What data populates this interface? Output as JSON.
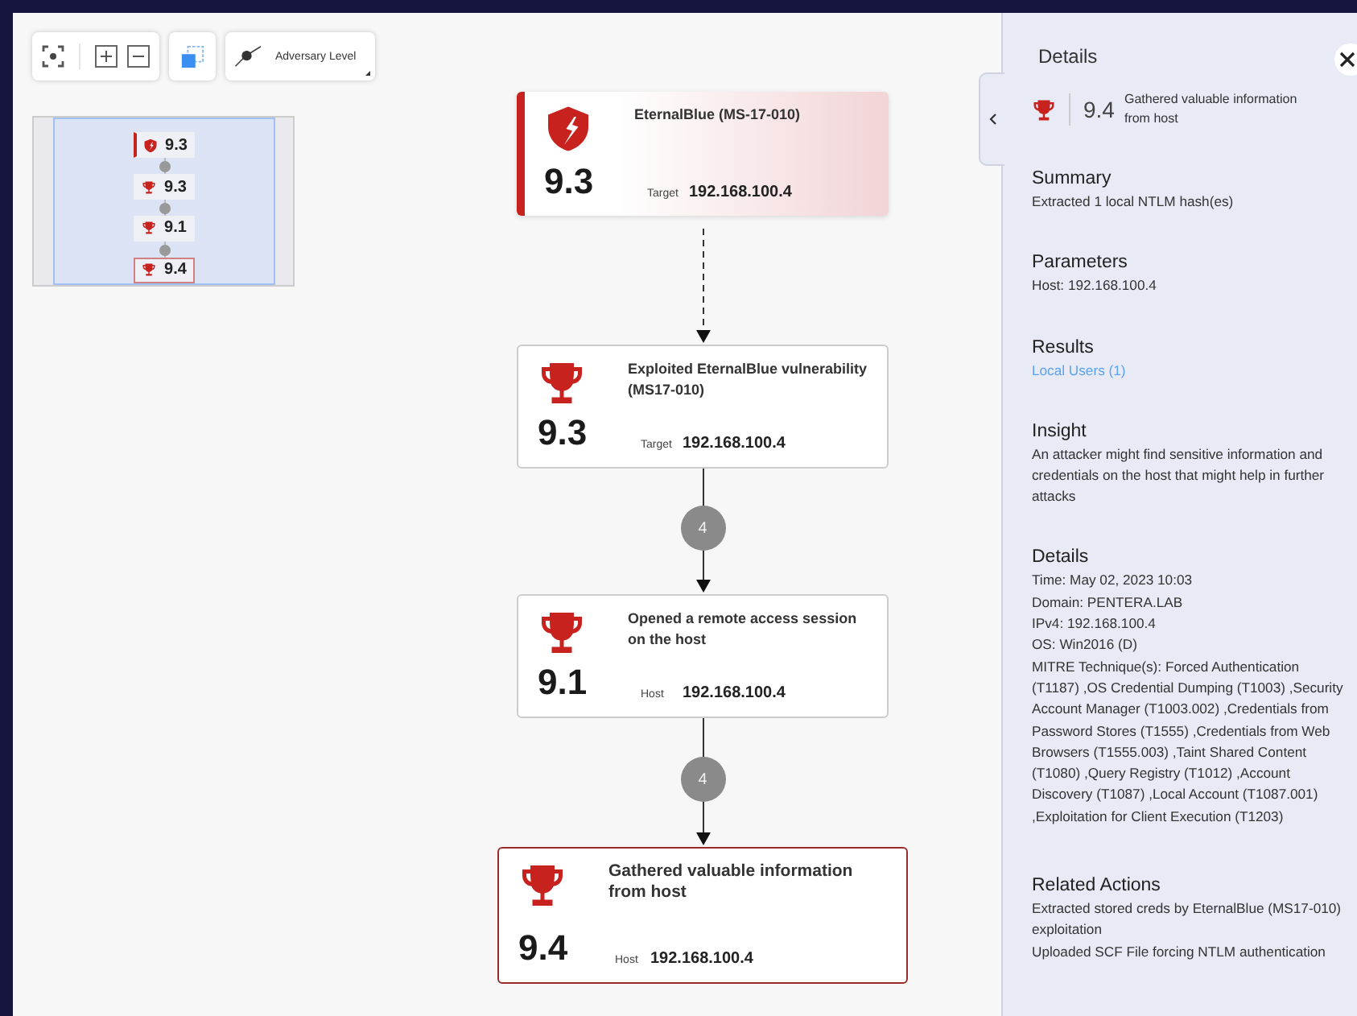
{
  "toolbar": {
    "adversary_level_label": "Adversary Level"
  },
  "minimap": {
    "items": [
      {
        "kind": "vulnerability",
        "score": "9.3",
        "selected": false
      },
      {
        "kind": "achievement",
        "score": "9.3",
        "selected": false
      },
      {
        "kind": "achievement",
        "score": "9.1",
        "selected": false
      },
      {
        "kind": "achievement",
        "score": "9.4",
        "selected": true
      }
    ]
  },
  "nodes": [
    {
      "kind": "vulnerability",
      "title": "EternalBlue (MS-17-010)",
      "score": "9.3",
      "target_label": "Target",
      "target": "192.168.100.4",
      "selected": false
    },
    {
      "kind": "achievement",
      "title": "Exploited EternalBlue vulnerability (MS17-010)",
      "score": "9.3",
      "target_label": "Target",
      "target": "192.168.100.4",
      "selected": false
    },
    {
      "kind": "achievement",
      "title": "Opened a remote access session on the host",
      "score": "9.1",
      "target_label": "Host",
      "target": "192.168.100.4",
      "selected": false
    },
    {
      "kind": "achievement",
      "title": "Gathered valuable information from host",
      "score": "9.4",
      "target_label": "Host",
      "target": "192.168.100.4",
      "selected": true
    }
  ],
  "connectors": [
    {
      "kind": "dashed"
    },
    {
      "kind": "count",
      "count": "4"
    },
    {
      "kind": "count",
      "count": "4"
    }
  ],
  "details_panel": {
    "title": "Details",
    "header": {
      "kind": "achievement",
      "score": "9.4",
      "title": "Gathered valuable information from host"
    },
    "sections": [
      {
        "kind": "text",
        "heading": "Summary",
        "lines": [
          "Extracted 1 local NTLM hash(es)"
        ]
      },
      {
        "kind": "text",
        "heading": "Parameters",
        "lines": [
          "Host: 192.168.100.4"
        ]
      },
      {
        "kind": "links",
        "heading": "Results",
        "lines": [
          "Local Users (1)"
        ]
      },
      {
        "kind": "text",
        "heading": "Insight",
        "lines": [
          "An attacker might find sensitive information and credentials on the host that might help in further attacks"
        ]
      },
      {
        "kind": "text",
        "heading": "Details",
        "lines": [
          "Time: May 02, 2023 10:03",
          "Domain: PENTERA.LAB",
          "IPv4: 192.168.100.4",
          "OS: Win2016 (D)",
          "MITRE Technique(s): Forced Authentication (T1187) ,OS Credential Dumping (T1003) ,Security Account Manager (T1003.002) ,Credentials from Password Stores (T1555) ,Credentials from Web Browsers (T1555.003) ,Taint Shared Content (T1080) ,Query Registry (T1012) ,Account Discovery (T1087) ,Local Account (T1087.001) ,Exploitation for Client Execution (T1203)"
        ]
      },
      {
        "kind": "text",
        "heading": "Related Actions",
        "lines": [
          "Extracted stored creds by EternalBlue (MS17-010) exploitation",
          "Uploaded SCF File forcing NTLM authentication"
        ]
      }
    ]
  }
}
